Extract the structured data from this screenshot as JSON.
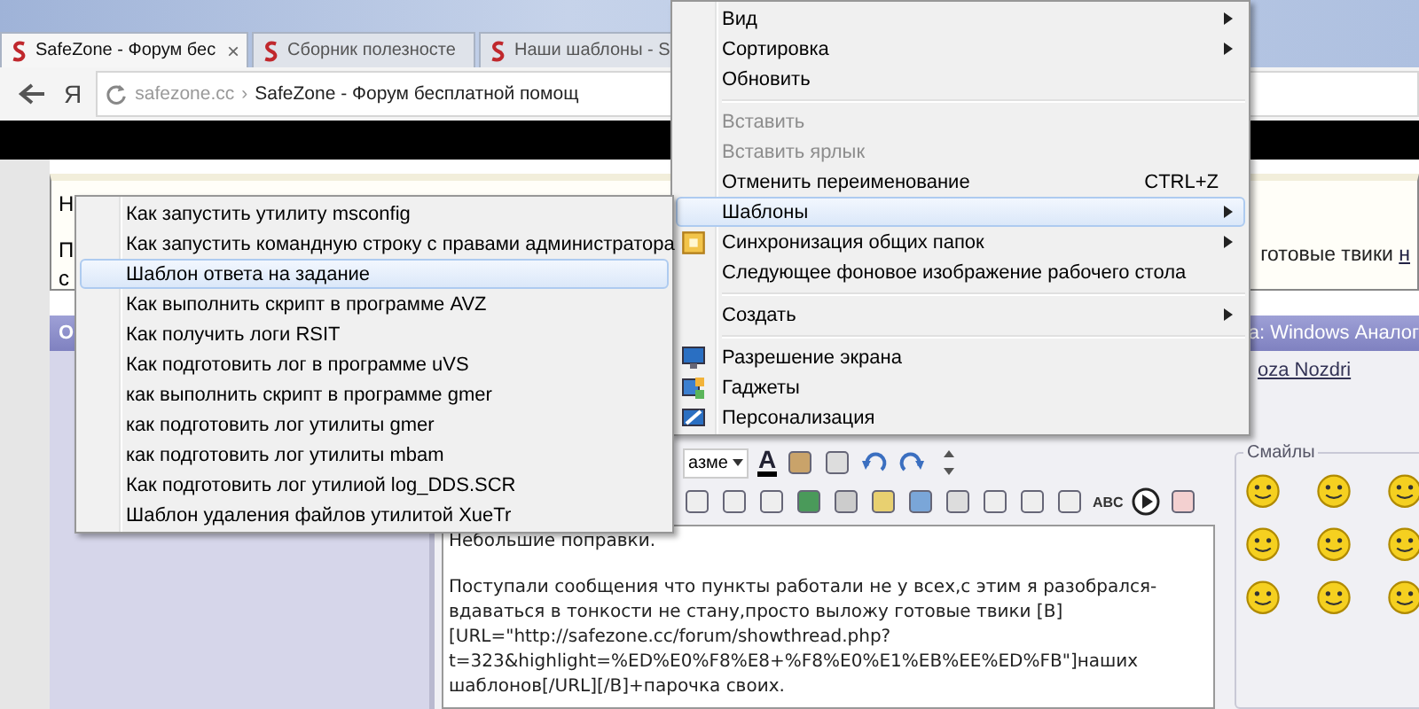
{
  "browser": {
    "tabs": [
      {
        "title": "SafeZone - Форум бес",
        "selected": true,
        "close": "×"
      },
      {
        "title": "Сборник полезносте",
        "selected": false
      },
      {
        "title": "Наши шаблоны - S",
        "selected": false
      }
    ],
    "home_button": "Я",
    "address": {
      "domain": "safezone.cc",
      "separator": "›",
      "title": "SafeZone - Форум бесплатной помощ"
    }
  },
  "page": {
    "notice": {
      "lines": [
        "Н",
        "П",
        "с"
      ],
      "right_text": "готовые твики",
      "right_link": "н"
    },
    "post_header": {
      "left": "О",
      "right": "а: Windows Аналог"
    },
    "author_link": "oza Nozdri",
    "editor": {
      "font_size_select": "азме",
      "font_color": "A",
      "spellcheck": "ABC",
      "title_line": "Небольшие поправки.",
      "lines": [
        "Поступали сообщения что пункты работали не у всех,с этим я разобрался-",
        "вдаваться в тонкости не стану,просто выложу готовые твики [B]",
        "[URL=\"http://safezone.cc/forum/showthread.php?",
        "t=323&highlight=%ED%E0%F8%E8+%F8%E0%E1%EB%EE%ED%FB\"]наших",
        "шаблонов[/URL][/B]+парочка своих."
      ]
    },
    "smilies": {
      "title": "Смайлы"
    }
  },
  "desktop_menu": {
    "items": [
      {
        "kind": "text",
        "label": "Вид",
        "submenu": true,
        "disabled": false,
        "selected": false
      },
      {
        "kind": "text",
        "label": "Сортировка",
        "submenu": true,
        "disabled": false,
        "selected": false
      },
      {
        "kind": "text",
        "label": "Обновить",
        "submenu": false,
        "disabled": false,
        "selected": false
      },
      {
        "kind": "separator"
      },
      {
        "kind": "text",
        "label": "Вставить",
        "submenu": false,
        "disabled": true,
        "selected": false
      },
      {
        "kind": "text",
        "label": "Вставить ярлык",
        "submenu": false,
        "disabled": true,
        "selected": false
      },
      {
        "kind": "text",
        "label": "Отменить переименование",
        "shortcut": "CTRL+Z",
        "submenu": false,
        "disabled": false,
        "selected": false
      },
      {
        "kind": "text",
        "label": "Шаблоны",
        "submenu": true,
        "disabled": false,
        "selected": true
      },
      {
        "kind": "sync",
        "label": "Синхронизация общих папок",
        "submenu": true,
        "disabled": false,
        "selected": false
      },
      {
        "kind": "text",
        "label": "Следующее фоновое изображение рабочего стола",
        "submenu": false,
        "disabled": false,
        "selected": false
      },
      {
        "kind": "separator"
      },
      {
        "kind": "text",
        "label": "Создать",
        "submenu": true,
        "disabled": false,
        "selected": false
      },
      {
        "kind": "separator"
      },
      {
        "kind": "screen",
        "label": "Разрешение экрана",
        "submenu": false,
        "disabled": false,
        "selected": false
      },
      {
        "kind": "gadgets",
        "label": "Гаджеты",
        "submenu": false,
        "disabled": false,
        "selected": false
      },
      {
        "kind": "personalize",
        "label": "Персонализация",
        "submenu": false,
        "disabled": false,
        "selected": false
      }
    ]
  },
  "templates_submenu": {
    "items": [
      {
        "label": "Как запустить утилиту msconfig",
        "selected": false
      },
      {
        "label": "Как запустить командную строку с правами администратора",
        "selected": false
      },
      {
        "label": "Шаблон ответа на задание",
        "selected": true
      },
      {
        "label": "Как выполнить скрипт в программе AVZ",
        "selected": false
      },
      {
        "label": "Как получить логи RSIT",
        "selected": false
      },
      {
        "label": "Как подготовить лог в программе uVS",
        "selected": false
      },
      {
        "label": "как выполнить скрипт в программе gmer",
        "selected": false
      },
      {
        "label": "как подготовить лог утилиты gmer",
        "selected": false
      },
      {
        "label": "как подготовить лог утилиты mbam",
        "selected": false
      },
      {
        "label": "Как подготовить лог утилиой log_DDS.SCR",
        "selected": false
      },
      {
        "label": "Шаблон удаления файлов утилитой XueTr",
        "selected": false
      }
    ]
  }
}
